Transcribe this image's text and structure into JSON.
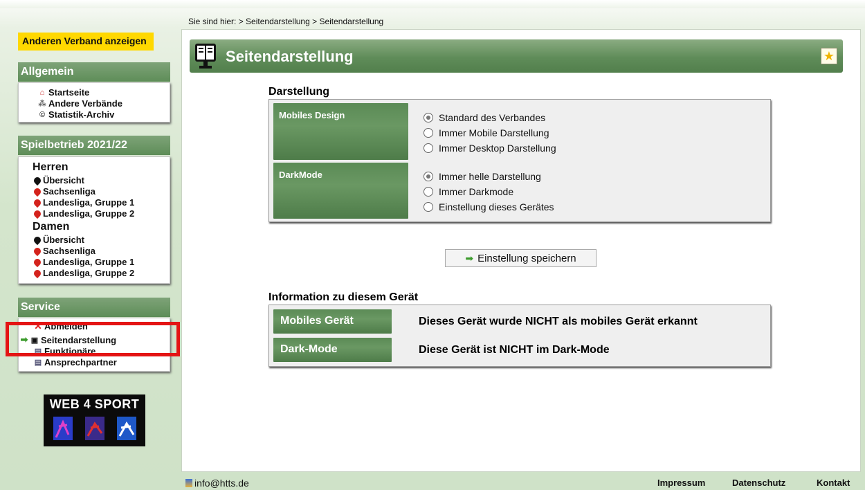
{
  "breadcrumb": "Sie sind hier: > Seitendarstellung > Seitendarstellung",
  "page_title": "Seitendarstellung",
  "darstellung": {
    "heading": "Darstellung",
    "mobiles_design": {
      "label": "Mobiles Design",
      "options": [
        "Standard des Verbandes",
        "Immer Mobile Darstellung",
        "Immer Desktop Darstellung"
      ],
      "selected": "Standard des Verbandes"
    },
    "darkmode": {
      "label": "DarkMode",
      "options": [
        "Immer helle Darstellung",
        "Immer Darkmode",
        "Einstellung dieses Gerätes"
      ],
      "selected": "Immer helle Darstellung"
    },
    "save_button": "Einstellung speichern"
  },
  "info": {
    "heading": "Information zu diesem Gerät",
    "rows": [
      {
        "label": "Mobiles Gerät",
        "value": "Dieses Gerät wurde NICHT als mobiles Gerät erkannt"
      },
      {
        "label": "Dark-Mode",
        "value": "Diese Gerät ist NICHT im Dark-Mode"
      }
    ]
  },
  "sidebar": {
    "switch_button": "Anderen Verband anzeigen",
    "allgemein": {
      "title": "Allgemein",
      "items": [
        "Startseite",
        "Andere Verbände",
        "Statistik-Archiv"
      ]
    },
    "spielbetrieb": {
      "title": "Spielbetrieb 2021/22",
      "groups": [
        {
          "name": "Herren",
          "items": [
            "Übersicht",
            "Sachsenliga",
            "Landesliga, Gruppe 1",
            "Landesliga, Gruppe 2"
          ]
        },
        {
          "name": "Damen",
          "items": [
            "Übersicht",
            "Sachsenliga",
            "Landesliga, Gruppe 1",
            "Landesliga, Gruppe 2"
          ]
        }
      ]
    },
    "service": {
      "title": "Service",
      "items": [
        "Abmelden",
        "Seitendarstellung",
        "Funktionäre",
        "Ansprechpartner"
      ],
      "active": "Seitendarstellung"
    },
    "logo_text": "WEB 4 SPORT"
  },
  "footer": {
    "email": "info@htts.de",
    "links": [
      "Impressum",
      "Datenschutz",
      "Kontakt"
    ]
  },
  "colors": {
    "accent_green": "#5f8c59",
    "highlight_red": "#e41414",
    "yellow": "#ffd800"
  }
}
